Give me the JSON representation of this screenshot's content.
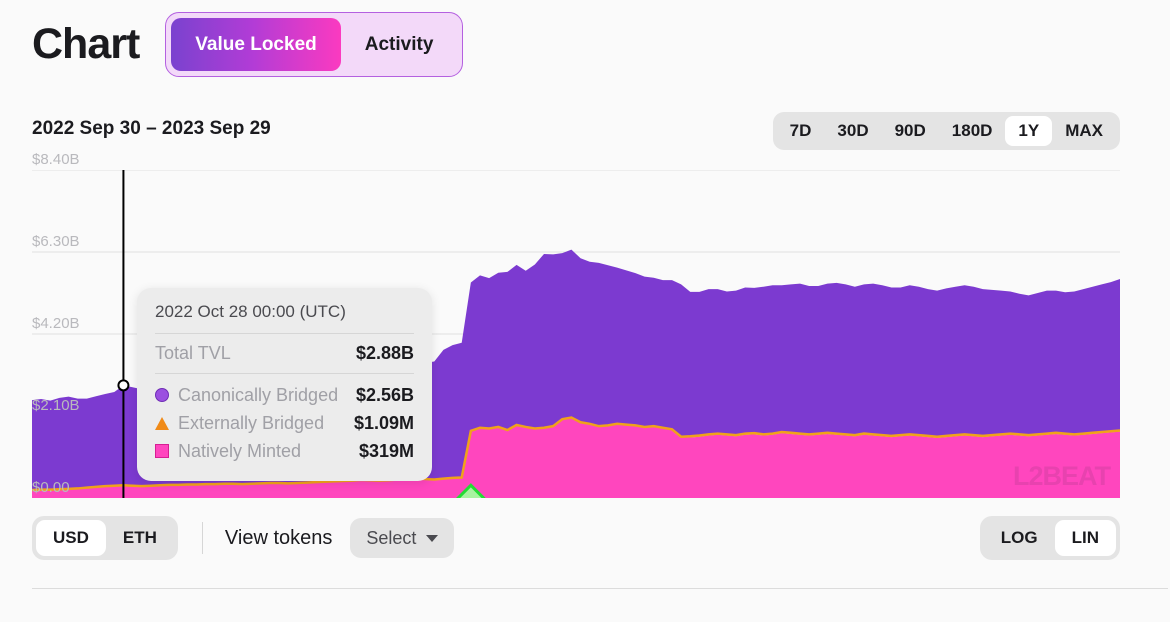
{
  "header": {
    "title": "Chart",
    "tabs": [
      {
        "label": "Value Locked",
        "active": true
      },
      {
        "label": "Activity",
        "active": false
      }
    ]
  },
  "subheader": {
    "date_range": "2022 Sep 30 – 2023 Sep 29",
    "timeframes": [
      {
        "label": "7D",
        "active": false
      },
      {
        "label": "30D",
        "active": false
      },
      {
        "label": "90D",
        "active": false
      },
      {
        "label": "180D",
        "active": false
      },
      {
        "label": "1Y",
        "active": true
      },
      {
        "label": "MAX",
        "active": false
      }
    ]
  },
  "tooltip": {
    "date": "2022 Oct 28 00:00 (UTC)",
    "total_label": "Total TVL",
    "total_value": "$2.88B",
    "rows": [
      {
        "marker": "circle-marker",
        "label": "Canonically Bridged",
        "value": "$2.56B"
      },
      {
        "marker": "triangle-marker",
        "label": "Externally Bridged",
        "value": "$1.09M"
      },
      {
        "marker": "square-marker",
        "label": "Natively Minted",
        "value": "$319M"
      }
    ]
  },
  "footer": {
    "currency": [
      {
        "label": "USD",
        "active": true
      },
      {
        "label": "ETH",
        "active": false
      }
    ],
    "view_tokens_label": "View tokens",
    "select_label": "Select",
    "scale": [
      {
        "label": "LOG",
        "active": false
      },
      {
        "label": "LIN",
        "active": true
      }
    ]
  },
  "watermark": "L2BEAT",
  "colors": {
    "canonically_bridged": "#7c3ad0",
    "externally_bridged": "#f0a21a",
    "natively_minted": "#ff46be",
    "accent_purple": "#7a42cf",
    "accent_pink": "#fb3ac0",
    "milestone_green": "#22dd33",
    "background": "#fafafa",
    "grid": "#e0e0e0"
  },
  "chart_data": {
    "type": "area",
    "title": "Value Locked",
    "subtitle": "2022 Sep 30 – 2023 Sep 29",
    "xlabel": "",
    "ylabel": "USD",
    "ylim": [
      0,
      8.4
    ],
    "y_unit": "B",
    "grid": true,
    "stacked": true,
    "legend": "tooltip",
    "yticks": [
      0,
      2.1,
      4.2,
      6.3,
      8.4
    ],
    "ytick_labels": [
      "$0.00",
      "$2.10B",
      "$4.20B",
      "$6.30B",
      "$8.40B"
    ],
    "x_start": "2022-09-30",
    "x_end": "2023-09-29",
    "n_points": 120,
    "cursor": {
      "index": 10,
      "date": "2022 Oct 28 00:00 (UTC)",
      "total": 2.88
    },
    "milestone": {
      "index": 48,
      "label": "milestone",
      "color": "#22dd33"
    },
    "series": [
      {
        "name": "Natively Minted",
        "color": "#ff46be",
        "values": [
          0.2,
          0.21,
          0.21,
          0.22,
          0.23,
          0.24,
          0.26,
          0.28,
          0.3,
          0.31,
          0.32,
          0.31,
          0.3,
          0.31,
          0.32,
          0.33,
          0.33,
          0.34,
          0.34,
          0.35,
          0.35,
          0.36,
          0.36,
          0.35,
          0.36,
          0.37,
          0.38,
          0.38,
          0.37,
          0.38,
          0.39,
          0.4,
          0.41,
          0.42,
          0.43,
          0.44,
          0.46,
          0.45,
          0.44,
          0.45,
          0.47,
          0.48,
          0.49,
          0.48,
          0.47,
          0.49,
          0.51,
          0.52,
          1.7,
          1.78,
          1.76,
          1.8,
          1.72,
          1.85,
          1.8,
          1.76,
          1.78,
          1.82,
          2.0,
          2.04,
          1.92,
          1.88,
          1.82,
          1.84,
          1.88,
          1.86,
          1.84,
          1.8,
          1.82,
          1.78,
          1.74,
          1.55,
          1.55,
          1.57,
          1.6,
          1.62,
          1.6,
          1.58,
          1.62,
          1.63,
          1.6,
          1.62,
          1.66,
          1.64,
          1.62,
          1.6,
          1.62,
          1.64,
          1.62,
          1.6,
          1.58,
          1.62,
          1.6,
          1.58,
          1.56,
          1.58,
          1.6,
          1.58,
          1.56,
          1.54,
          1.56,
          1.58,
          1.6,
          1.58,
          1.56,
          1.58,
          1.6,
          1.62,
          1.6,
          1.58,
          1.6,
          1.62,
          1.64,
          1.62,
          1.6,
          1.62,
          1.64,
          1.66,
          1.68,
          1.7
        ]
      },
      {
        "name": "Externally Bridged",
        "color": "#f0a21a",
        "values": [
          0.005,
          0.005,
          0.005,
          0.005,
          0.005,
          0.005,
          0.005,
          0.005,
          0.005,
          0.005,
          0.005,
          0.005,
          0.005,
          0.005,
          0.005,
          0.005,
          0.005,
          0.005,
          0.005,
          0.005,
          0.005,
          0.005,
          0.005,
          0.005,
          0.005,
          0.005,
          0.005,
          0.005,
          0.005,
          0.005,
          0.005,
          0.005,
          0.005,
          0.005,
          0.005,
          0.005,
          0.005,
          0.005,
          0.005,
          0.005,
          0.005,
          0.005,
          0.005,
          0.005,
          0.005,
          0.005,
          0.005,
          0.005,
          0.02,
          0.02,
          0.02,
          0.02,
          0.02,
          0.02,
          0.02,
          0.02,
          0.02,
          0.02,
          0.02,
          0.02,
          0.02,
          0.02,
          0.02,
          0.02,
          0.02,
          0.02,
          0.02,
          0.02,
          0.02,
          0.02,
          0.02,
          0.02,
          0.03,
          0.03,
          0.03,
          0.03,
          0.03,
          0.03,
          0.03,
          0.03,
          0.03,
          0.03,
          0.03,
          0.03,
          0.03,
          0.03,
          0.03,
          0.03,
          0.03,
          0.03,
          0.03,
          0.03,
          0.03,
          0.03,
          0.03,
          0.03,
          0.03,
          0.03,
          0.03,
          0.03,
          0.03,
          0.03,
          0.03,
          0.03,
          0.03,
          0.03,
          0.03,
          0.03,
          0.03,
          0.03,
          0.03,
          0.03,
          0.03,
          0.03,
          0.03,
          0.03,
          0.03,
          0.03,
          0.03,
          0.03
        ]
      },
      {
        "name": "Canonically Bridged",
        "color": "#7c3ad0",
        "values": [
          2.3,
          2.32,
          2.28,
          2.34,
          2.36,
          2.3,
          2.28,
          2.32,
          2.36,
          2.4,
          2.56,
          2.52,
          2.48,
          2.5,
          2.55,
          2.6,
          2.58,
          2.62,
          2.66,
          2.7,
          2.68,
          2.72,
          2.74,
          2.7,
          2.72,
          2.76,
          2.8,
          2.78,
          2.74,
          2.76,
          2.8,
          2.82,
          2.86,
          2.88,
          2.9,
          2.92,
          3.1,
          3.12,
          3.08,
          3.14,
          3.18,
          3.1,
          3.05,
          2.98,
          3.02,
          3.3,
          3.4,
          3.45,
          3.8,
          3.9,
          3.85,
          3.95,
          4.05,
          4.1,
          4.0,
          4.2,
          4.45,
          4.4,
          4.25,
          4.3,
          4.2,
          4.15,
          4.18,
          4.1,
          4.0,
          3.95,
          3.9,
          3.85,
          3.8,
          3.78,
          3.82,
          3.9,
          3.7,
          3.68,
          3.72,
          3.7,
          3.66,
          3.7,
          3.74,
          3.72,
          3.78,
          3.8,
          3.76,
          3.8,
          3.84,
          3.8,
          3.78,
          3.82,
          3.86,
          3.84,
          3.8,
          3.82,
          3.86,
          3.84,
          3.8,
          3.78,
          3.82,
          3.8,
          3.76,
          3.74,
          3.78,
          3.8,
          3.82,
          3.8,
          3.76,
          3.72,
          3.68,
          3.64,
          3.6,
          3.58,
          3.62,
          3.66,
          3.64,
          3.62,
          3.66,
          3.7,
          3.74,
          3.78,
          3.82,
          3.88
        ]
      }
    ]
  }
}
